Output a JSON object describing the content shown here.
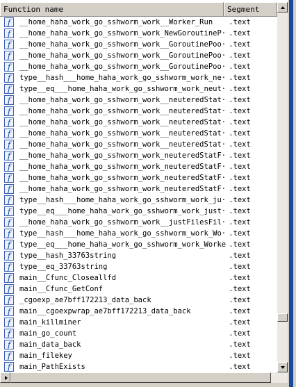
{
  "columns": {
    "name": "Function name",
    "segment": "Segment"
  },
  "icon": "function-icon",
  "icon_glyph": "f",
  "rows": [
    {
      "name": "__home_haha_work_go_sshworm_work__Worker_Run",
      "segment": ".text"
    },
    {
      "name": "__home_haha_work_go_sshworm_work_NewGoroutineP···",
      "segment": ".text"
    },
    {
      "name": "__home_haha_work_go_sshworm_work__GoroutinePoo···",
      "segment": ".text"
    },
    {
      "name": "__home_haha_work_go_sshworm_work__GoroutinePoo···",
      "segment": ".text"
    },
    {
      "name": "__home_haha_work_go_sshworm_work__GoroutinePoo···",
      "segment": ".text"
    },
    {
      "name": "type__hash___home_haha_work_go_sshworm_work_ne···",
      "segment": ".text"
    },
    {
      "name": "type__eq___home_haha_work_go_sshworm_work_neut···",
      "segment": ".text"
    },
    {
      "name": "__home_haha_work_go_sshworm_work__neuteredStat···",
      "segment": ".text"
    },
    {
      "name": "__home_haha_work_go_sshworm_work__neuteredStat···",
      "segment": ".text"
    },
    {
      "name": "__home_haha_work_go_sshworm_work__neuteredStat···",
      "segment": ".text"
    },
    {
      "name": "__home_haha_work_go_sshworm_work__neuteredStat···",
      "segment": ".text"
    },
    {
      "name": "__home_haha_work_go_sshworm_work__neuteredStat···",
      "segment": ".text"
    },
    {
      "name": "__home_haha_work_go_sshworm_work_neuteredStatF···",
      "segment": ".text"
    },
    {
      "name": "__home_haha_work_go_sshworm_work_neuteredStatF···",
      "segment": ".text"
    },
    {
      "name": "__home_haha_work_go_sshworm_work_neuteredStatF···",
      "segment": ".text"
    },
    {
      "name": "__home_haha_work_go_sshworm_work_neuteredStatF···",
      "segment": ".text"
    },
    {
      "name": "type__hash___home_haha_work_go_sshworm_work_ju···",
      "segment": ".text"
    },
    {
      "name": "type__eq___home_haha_work_go_sshworm_work_just···",
      "segment": ".text"
    },
    {
      "name": "__home_haha_work_go_sshworm_work__justFilesFil···",
      "segment": ".text"
    },
    {
      "name": "type__hash___home_haha_work_go_sshworm_work_Wo···",
      "segment": ".text"
    },
    {
      "name": "type__eq___home_haha_work_go_sshworm_work_Worker",
      "segment": ".text"
    },
    {
      "name": "type__hash_33763string",
      "segment": ".text"
    },
    {
      "name": "type__eq_33763string",
      "segment": ".text"
    },
    {
      "name": "main__Cfunc_Closeallfd",
      "segment": ".text"
    },
    {
      "name": "main__Cfunc_GetConf",
      "segment": ".text"
    },
    {
      "name": "_cgoexp_ae7bff172213_data_back",
      "segment": ".text"
    },
    {
      "name": "main__cgoexpwrap_ae7bff172213_data_back",
      "segment": ".text"
    },
    {
      "name": "main_killminer",
      "segment": ".text"
    },
    {
      "name": "main_go_count",
      "segment": ".text"
    },
    {
      "name": "main_data_back",
      "segment": ".text"
    },
    {
      "name": "main_filekey",
      "segment": ".text"
    },
    {
      "name": "main_PathExists",
      "segment": ".text"
    }
  ]
}
